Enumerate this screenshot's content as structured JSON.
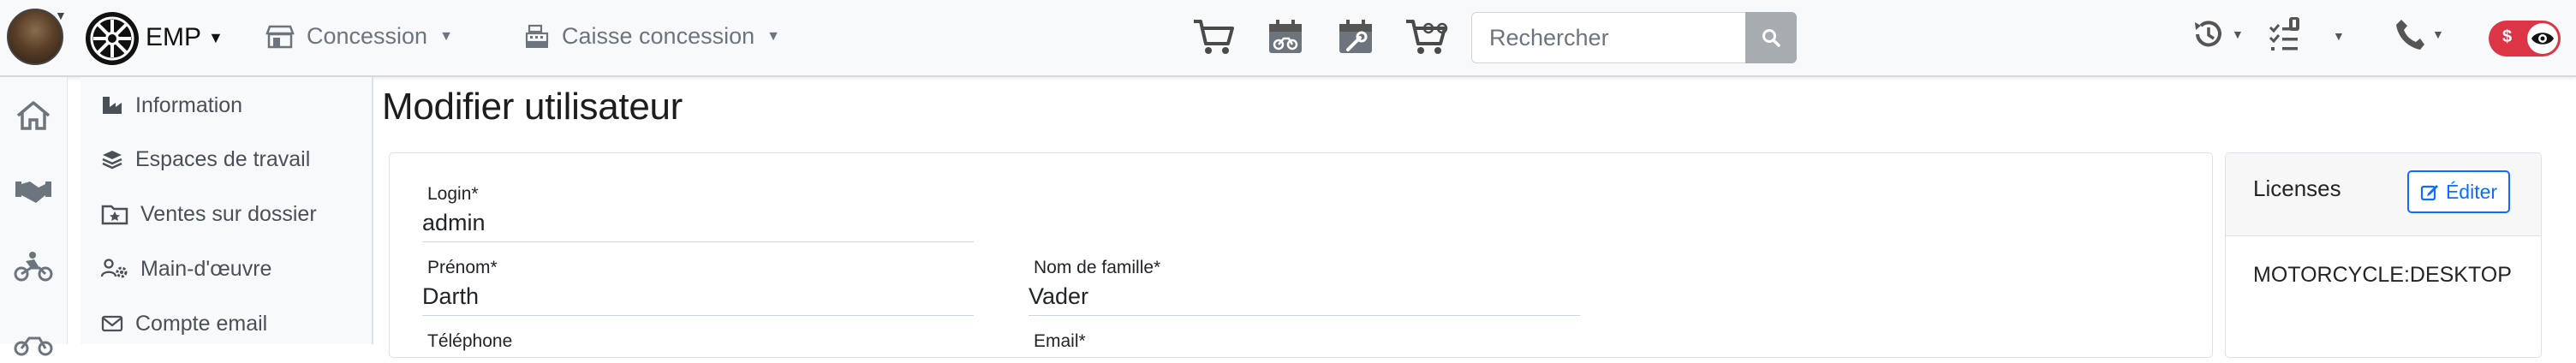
{
  "header": {
    "brand": "EMP",
    "nav": [
      {
        "label": "Concession"
      },
      {
        "label": "Caisse concession"
      }
    ],
    "icons": [
      "cart-icon",
      "calendar-motorcycle-icon",
      "calendar-wrench-icon",
      "cart-motorcycle-icon"
    ],
    "search": {
      "placeholder": "Rechercher",
      "value": ""
    },
    "toggle": {
      "symbol": "$",
      "state": "off",
      "color": "#dc3545"
    }
  },
  "rail": {
    "icons": [
      "home-icon",
      "handshake-icon",
      "motorcycle-rider-icon",
      "motorcycle-icon"
    ]
  },
  "submenu": {
    "items": [
      {
        "label": "Information",
        "icon": "industry-icon"
      },
      {
        "label": "Espaces de travail",
        "icon": "layers-icon"
      },
      {
        "label": "Ventes sur dossier",
        "icon": "folder-star-icon"
      },
      {
        "label": "Main-d'œuvre",
        "icon": "users-gear-icon"
      },
      {
        "label": "Compte email",
        "icon": "envelope-icon"
      }
    ]
  },
  "page": {
    "title": "Modifier utilisateur"
  },
  "form": {
    "login": {
      "label": "Login*",
      "value": "admin"
    },
    "prenom": {
      "label": "Prénom*",
      "value": "Darth"
    },
    "nom": {
      "label": "Nom de famille*",
      "value": "Vader"
    },
    "telephone": {
      "label": "Téléphone",
      "value": ""
    },
    "email": {
      "label": "Email*",
      "value": ""
    }
  },
  "licenses": {
    "title": "Licenses",
    "edit_label": "Éditer",
    "value": "MOTORCYCLE:DESKTOP"
  },
  "colors": {
    "accent": "#0d6efd",
    "navbar_bg": "#f8f9fa",
    "toggle_red": "#dc3545"
  }
}
